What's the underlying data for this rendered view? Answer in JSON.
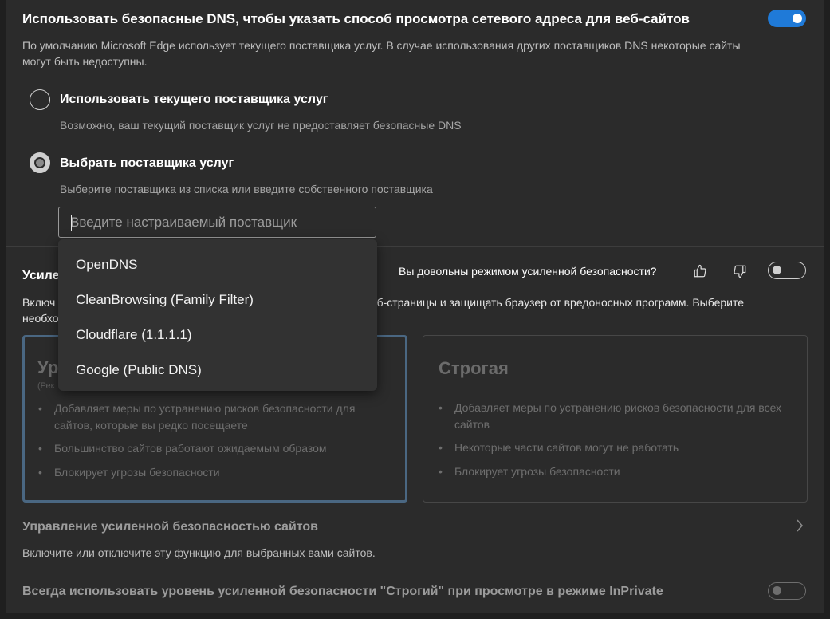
{
  "dns": {
    "title": "Использовать безопасные DNS, чтобы указать способ просмотра сетевого адреса для веб-сайтов",
    "description_line1": "По умолчанию Microsoft Edge использует текущего поставщика услуг. В случае использования других поставщиков DNS некоторые сайты",
    "description_line2": "могут быть недоступны.",
    "toggle_state": "on",
    "option_current": {
      "title": "Использовать текущего поставщика услуг",
      "description": "Возможно, ваш текущий поставщик услуг не предоставляет безопасные DNS"
    },
    "option_choose": {
      "title": "Выбрать поставщика услуг",
      "description": "Выберите поставщика из списка или введите собственного поставщика"
    },
    "provider_input": {
      "placeholder": "Введите настраиваемый поставщик",
      "value": ""
    },
    "providers": [
      "OpenDNS",
      "CleanBrowsing (Family Filter)",
      "Cloudflare (1.1.1.1)",
      "Google (Public DNS)"
    ]
  },
  "enhanced": {
    "title_visible": "Усиле",
    "feedback_question": "Вы довольны режимом усиленной безопасности?",
    "description_left_line1": "Включ",
    "description_left_line2": "необхо",
    "description_right": "еб-страницы и защищать браузер от вредоносных программ. Выберите",
    "toggle_state": "off",
    "cards": {
      "balanced": {
        "title_visible": "Ур",
        "subtitle_visible": "(Рек",
        "bullets": [
          "Добавляет меры по устранению рисков безопасности для сайтов, которые вы редко посещаете",
          "Большинство сайтов работают ожидаемым образом",
          "Блокирует угрозы безопасности"
        ]
      },
      "strict": {
        "title": "Строгая",
        "bullets": [
          "Добавляет меры по устранению рисков безопасности для всех сайтов",
          "Некоторые части сайтов могут не работать",
          "Блокирует угрозы безопасности"
        ]
      }
    }
  },
  "manage": {
    "title": "Управление усиленной безопасностью сайтов",
    "description": "Включите или отключите эту функцию для выбранных вами сайтов."
  },
  "inprivate": {
    "title": "Всегда использовать уровень усиленной безопасности \"Строгий\" при просмотре в режиме InPrivate",
    "toggle_state": "off"
  },
  "colors": {
    "accent": "#1f7ad8",
    "background": "#2b2b2b"
  }
}
